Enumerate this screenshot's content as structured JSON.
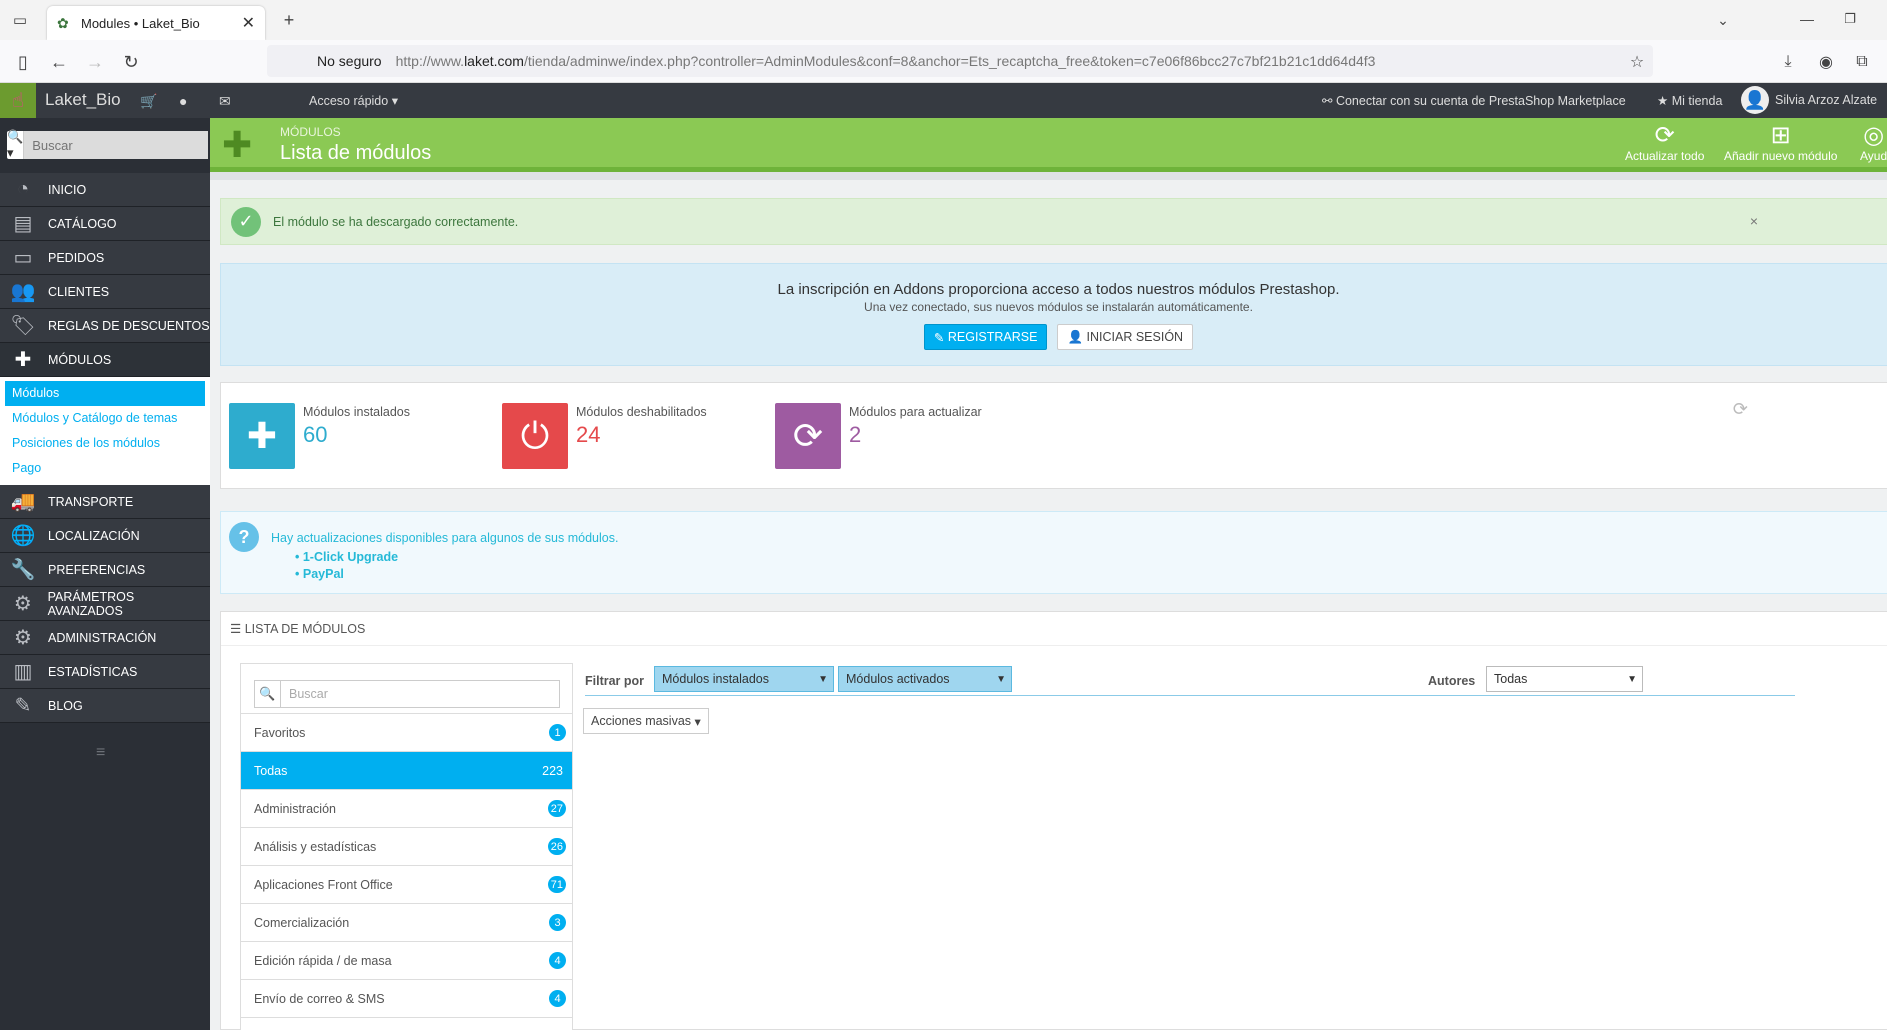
{
  "browser": {
    "tab_title": "Modules • Laket_Bio",
    "security_label": "No seguro",
    "url_prefix": "http://www.",
    "url_host": "laket.com",
    "url_rest": "/tienda/adminwe/index.php?controller=AdminModules&conf=8&anchor=Ets_recaptcha_free&token=c7e06f86bcc27c7bf21b21c1dd64d4f3"
  },
  "header": {
    "shop_name": "Laket_Bio",
    "quick_access": "Acceso rápido",
    "marketplace": "Conectar con su cuenta de PrestaShop Marketplace",
    "my_shop": "Mi tienda",
    "user": "Silvia Arzoz Alzate"
  },
  "sidebar": {
    "search_placeholder": "Buscar",
    "items": [
      {
        "label": "Inicio",
        "icon": "dashboard-icon"
      },
      {
        "label": "Catálogo",
        "icon": "book-icon"
      },
      {
        "label": "Pedidos",
        "icon": "credit-card-icon"
      },
      {
        "label": "Clientes",
        "icon": "users-icon"
      },
      {
        "label": "Reglas de descuentos",
        "icon": "tags-icon"
      },
      {
        "label": "Módulos",
        "icon": "puzzle-icon"
      }
    ],
    "submenu": [
      "Módulos",
      "Módulos y Catálogo de temas",
      "Posiciones de los módulos",
      "Pago"
    ],
    "items2": [
      {
        "label": "Transporte",
        "icon": "truck-icon"
      },
      {
        "label": "Localización",
        "icon": "globe-icon"
      },
      {
        "label": "Preferencias",
        "icon": "wrench-icon"
      },
      {
        "label": "Parámetros avanzados",
        "icon": "cogs-icon"
      },
      {
        "label": "Administración",
        "icon": "cog-icon"
      },
      {
        "label": "Estadísticas",
        "icon": "bar-chart-icon"
      },
      {
        "label": "Blog",
        "icon": "pencil-icon"
      }
    ]
  },
  "toolbar": {
    "breadcrumb": "Módulos",
    "title": "Lista de módulos",
    "btn_update_all": "Actualizar todo",
    "btn_add_module": "Añadir nuevo módulo",
    "btn_help": "Ayud"
  },
  "alert": {
    "text": "El módulo se ha descargado correctamente."
  },
  "addons": {
    "heading": "La inscripción en Addons proporciona acceso a todos nuestros módulos Prestashop.",
    "sub": "Una vez conectado, sus nuevos módulos se instalarán automáticamente.",
    "register": "REGISTRARSE",
    "login": "INICIAR SESIÓN"
  },
  "kpis": [
    {
      "label": "Módulos instalados",
      "value": "60",
      "color": "#2eacce"
    },
    {
      "label": "Módulos deshabilitados",
      "value": "24",
      "color": "#e5494b"
    },
    {
      "label": "Módulos para actualizar",
      "value": "2",
      "color": "#9e5ba1"
    }
  ],
  "updates": {
    "text": "Hay actualizaciones disponibles para algunos de sus módulos.",
    "items": [
      "1-Click Upgrade",
      "PayPal"
    ]
  },
  "list": {
    "title": "Lista de módulos",
    "search_placeholder": "Buscar",
    "categories": [
      {
        "name": "Favoritos",
        "count": "1"
      },
      {
        "name": "Todas",
        "count": "223"
      },
      {
        "name": "Administración",
        "count": "27"
      },
      {
        "name": "Análisis y estadísticas",
        "count": "26"
      },
      {
        "name": "Aplicaciones Front Office",
        "count": "71"
      },
      {
        "name": "Comercialización",
        "count": "3"
      },
      {
        "name": "Edición rápida / de masa",
        "count": "4"
      },
      {
        "name": "Envío de correo & SMS",
        "count": "4"
      }
    ],
    "filter_label": "Filtrar por",
    "filter_installed": "Módulos instalados",
    "filter_enabled": "Módulos activados",
    "authors_label": "Autores",
    "authors_value": "Todas",
    "bulk_actions": "Acciones masivas"
  }
}
